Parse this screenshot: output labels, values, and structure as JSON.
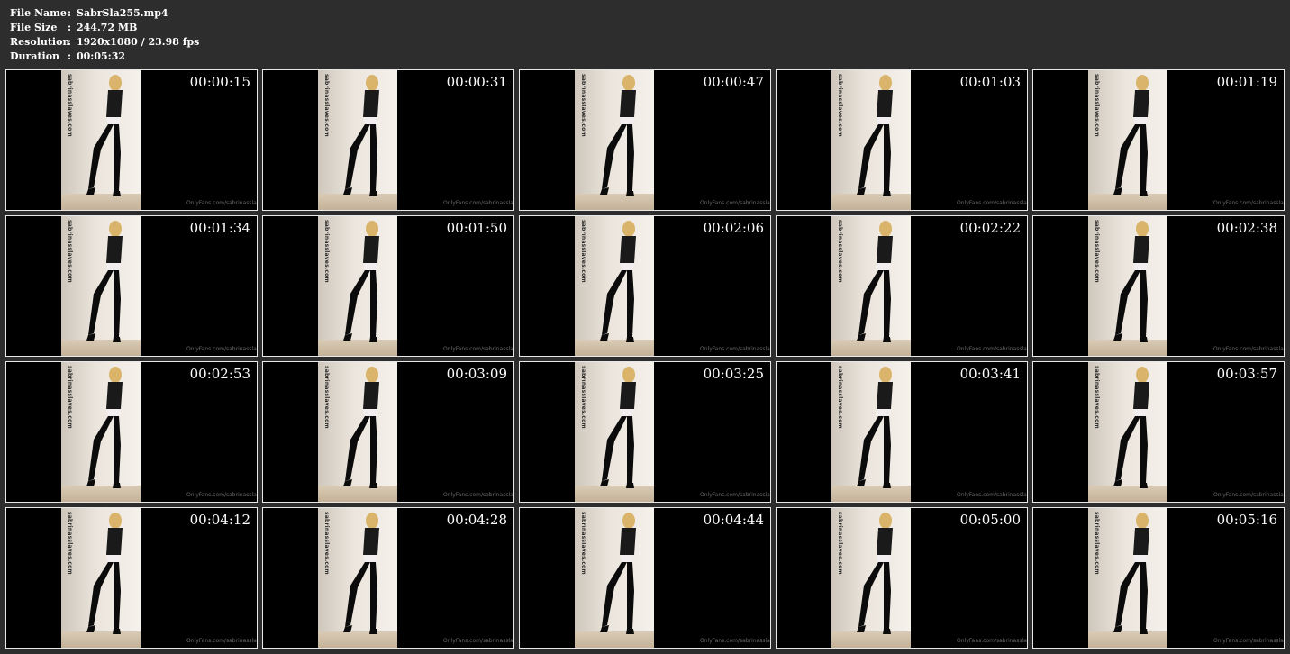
{
  "info": [
    {
      "label": "File Name",
      "colon": ":",
      "value": "SabrSla255.mp4"
    },
    {
      "label": "File Size",
      "colon": ":",
      "value": "244.72 MB"
    },
    {
      "label": "Resolution",
      "colon": ":",
      "value": "1920x1080 / 23.98 fps"
    },
    {
      "label": "Duration",
      "colon": ":",
      "value": "00:05:32"
    }
  ],
  "watermark": "sabrinasslaves.com",
  "overlay_text": "OnlyFans.com/sabrinasslaves",
  "timestamps": [
    "00:00:15",
    "00:00:31",
    "00:00:47",
    "00:01:03",
    "00:01:19",
    "00:01:34",
    "00:01:50",
    "00:02:06",
    "00:02:22",
    "00:02:38",
    "00:02:53",
    "00:03:09",
    "00:03:25",
    "00:03:41",
    "00:03:57",
    "00:04:12",
    "00:04:28",
    "00:04:44",
    "00:05:00",
    "00:05:16"
  ],
  "colors": {
    "background": "#2d2d2d",
    "text": "#ffffff",
    "thumb_border": "#e8e8e8"
  }
}
